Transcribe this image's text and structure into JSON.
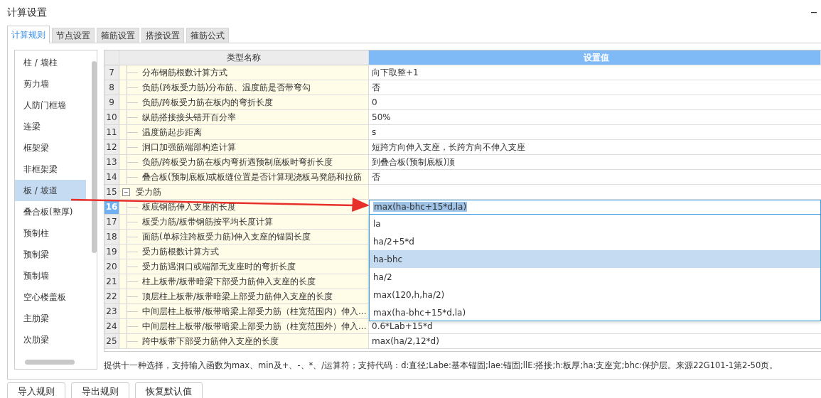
{
  "window": {
    "title": "计算设置"
  },
  "tabs": [
    {
      "label": "计算规则",
      "selected": true
    },
    {
      "label": "节点设置",
      "selected": false
    },
    {
      "label": "箍筋设置",
      "selected": false
    },
    {
      "label": "搭接设置",
      "selected": false
    },
    {
      "label": "箍筋公式",
      "selected": false
    }
  ],
  "sidebar": {
    "items": [
      {
        "label": "柱 / 墙柱",
        "selected": false
      },
      {
        "label": "剪力墙",
        "selected": false
      },
      {
        "label": "人防门框墙",
        "selected": false
      },
      {
        "label": "连梁",
        "selected": false
      },
      {
        "label": "框架梁",
        "selected": false
      },
      {
        "label": "非框架梁",
        "selected": false
      },
      {
        "label": "板 / 坡道",
        "selected": true
      },
      {
        "label": "叠合板(整厚)",
        "selected": false
      },
      {
        "label": "预制柱",
        "selected": false
      },
      {
        "label": "预制梁",
        "selected": false
      },
      {
        "label": "预制墙",
        "selected": false
      },
      {
        "label": "空心楼盖板",
        "selected": false
      },
      {
        "label": "主肋梁",
        "selected": false
      },
      {
        "label": "次肋梁",
        "selected": false
      }
    ]
  },
  "table": {
    "columns": [
      "类型名称",
      "设置值"
    ],
    "rows": [
      {
        "kind": "item",
        "number": "7",
        "name": "分布钢筋根数计算方式",
        "value": "向下取整+1",
        "selected": false
      },
      {
        "kind": "item",
        "number": "8",
        "name": "负筋(跨板受力筋)分布筋、温度筋是否带弯勾",
        "value": "否",
        "selected": false
      },
      {
        "kind": "item",
        "number": "9",
        "name": "负筋/跨板受力筋在板内的弯折长度",
        "value": "0",
        "selected": false
      },
      {
        "kind": "item",
        "number": "10",
        "name": "纵筋搭接接头错开百分率",
        "value": "50%",
        "selected": false
      },
      {
        "kind": "item",
        "number": "11",
        "name": "温度筋起步距离",
        "value": "s",
        "selected": false
      },
      {
        "kind": "item",
        "number": "12",
        "name": "洞口加强筋端部构造计算",
        "value": "短跨方向伸入支座，长跨方向不伸入支座",
        "selected": false
      },
      {
        "kind": "item",
        "number": "13",
        "name": "负筋/跨板受力筋在板内弯折遇预制底板时弯折长度",
        "value": "到叠合板(预制底板)顶",
        "selected": false
      },
      {
        "kind": "item",
        "number": "14",
        "name": "叠合板(预制底板)或板缝位置是否计算现浇板马凳筋和拉筋",
        "value": "否",
        "selected": false
      },
      {
        "kind": "group",
        "number": "15",
        "name": "受力筋",
        "toggle": "−",
        "selected": false
      },
      {
        "kind": "item",
        "number": "16",
        "name": "板底钢筋伸入支座的长度",
        "value": "max(ha-bhc+15*d,la)",
        "selected": true
      },
      {
        "kind": "item",
        "number": "17",
        "name": "板受力筋/板带钢筋按平均长度计算",
        "selected": false
      },
      {
        "kind": "item",
        "number": "18",
        "name": "面筋(单标注跨板受力筋)伸入支座的锚固长度",
        "selected": false
      },
      {
        "kind": "item",
        "number": "19",
        "name": "受力筋根数计算方式",
        "selected": false
      },
      {
        "kind": "item",
        "number": "20",
        "name": "受力筋遇洞口或端部无支座时的弯折长度",
        "selected": false
      },
      {
        "kind": "item",
        "number": "21",
        "name": "柱上板带/板带暗梁下部受力筋伸入支座的长度",
        "selected": false
      },
      {
        "kind": "item",
        "number": "22",
        "name": "顶层柱上板带/板带暗梁上部受力筋伸入支座的长度",
        "selected": false
      },
      {
        "kind": "item",
        "number": "23",
        "name": "中间层柱上板带/板带暗梁上部受力筋（柱宽范围内）伸入...",
        "selected": false
      },
      {
        "kind": "item",
        "number": "24",
        "name": "中间层柱上板带/板带暗梁上部受力筋（柱宽范围外）伸入...",
        "value": "0.6*Lab+15*d",
        "selected": false
      },
      {
        "kind": "item",
        "number": "25",
        "name": "跨中板带下部受力筋伸入支座的长度",
        "value": "max(ha/2,12*d)",
        "selected": false
      }
    ]
  },
  "dropdown": {
    "options": [
      {
        "label": "la",
        "selected": false
      },
      {
        "label": "ha/2+5*d",
        "selected": false
      },
      {
        "label": "ha-bhc",
        "selected": true
      },
      {
        "label": "ha/2",
        "selected": false
      },
      {
        "label": "max(120,h,ha/2)",
        "selected": false
      },
      {
        "label": "max(ha-bhc+15*d,la)",
        "selected": false
      }
    ]
  },
  "note": "提供十一种选择，支持输入函数为max、min及+、-、*、/运算符；支持代码：d:直径;Labe:基本锚固;lae:锚固;llE:搭接;h:板厚;ha:支座宽;bhc:保护层。来源22G101-1第2-50页。",
  "buttons": [
    "导入规则",
    "导出规则",
    "恢复默认值"
  ]
}
